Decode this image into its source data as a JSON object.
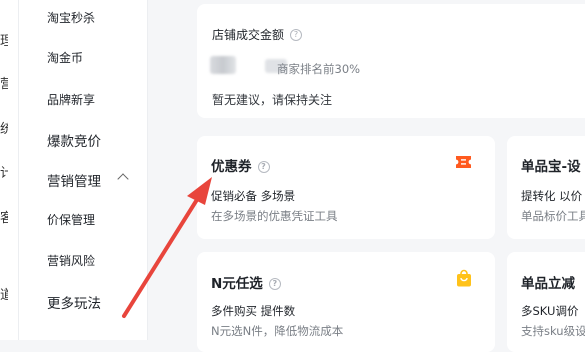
{
  "left_rail": {
    "glyphs": [
      "理",
      "营",
      "统",
      "计",
      "客",
      "道"
    ]
  },
  "sidebar": {
    "items": [
      {
        "label": "淘宝秒杀"
      },
      {
        "label": "淘金币"
      },
      {
        "label": "品牌新享"
      },
      {
        "label": "爆款竞价"
      },
      {
        "label": "营销管理"
      },
      {
        "label": "价保管理"
      },
      {
        "label": "营销风险"
      },
      {
        "label": "更多玩法"
      }
    ]
  },
  "stats_card": {
    "title": "店铺成交金额",
    "help_icon": "?",
    "rank_text": "商家排名前30%",
    "suggestion": "暂无建议，请保持关注"
  },
  "tools": [
    {
      "title": "优惠券",
      "help_icon": "?",
      "tags": "促销必备  多场景",
      "desc": "在多场景的优惠凭证工具",
      "icon": "coupon-icon",
      "icon_color": "#ff5a1f"
    },
    {
      "title": "单品宝-设",
      "tags": "提转化  以价",
      "desc": "单品标价工具"
    },
    {
      "title": "N元任选",
      "help_icon": "?",
      "tags": "多件购买  提件数",
      "desc": "N元选N件，降低物流成本",
      "icon": "shopping-bag-icon",
      "icon_color": "#ffc21a"
    },
    {
      "title": "单品立减",
      "tags": "多SKU调价",
      "desc": "支持sku级设"
    }
  ],
  "annotation": {
    "arrow_color": "#e8453c"
  }
}
